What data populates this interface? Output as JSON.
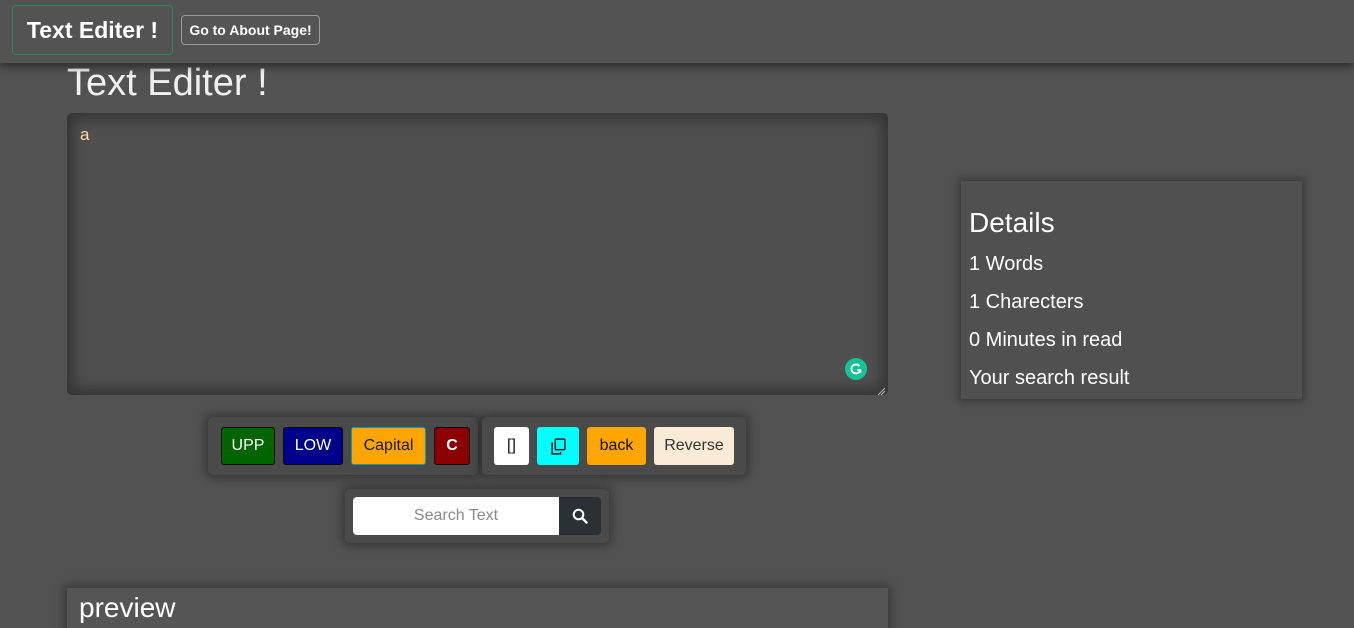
{
  "navbar": {
    "brand": "Text Editer !",
    "about_button": "Go to About Page!"
  },
  "main": {
    "title": "Text Editer !",
    "editor_value": "a"
  },
  "buttons": {
    "upper": "UPP",
    "lower": "LOW",
    "capital": "Capital",
    "clear": "C",
    "brackets": "[]",
    "back": "back",
    "reverse": "Reverse"
  },
  "search": {
    "placeholder": "Search Text",
    "icon": "search-icon"
  },
  "details": {
    "title": "Details",
    "words": "1 Words",
    "characters": "1 Charecters",
    "read_time": "0 Minutes in read",
    "search_result": "Your search result"
  },
  "preview": {
    "title": "preview"
  },
  "colors": {
    "background": "#525252",
    "upp": "#006400",
    "low": "#00008b",
    "capital": "#ffa500",
    "clear": "#8b0000",
    "copy": "#00ffff",
    "back": "#ffa500",
    "reverse": "#faebd7"
  }
}
